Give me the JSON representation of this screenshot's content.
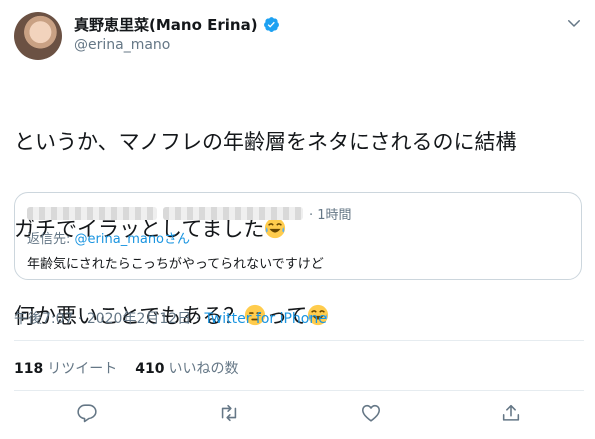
{
  "author": {
    "display_name": "真野恵里菜(Mano Erina)",
    "handle": "@erina_mano",
    "verified": true
  },
  "tweet": {
    "line1": "というか、マノフレの年齢層をネタにされるのに結構",
    "line2": "ガチでイラッとしてました",
    "line3_a": "何か悪いことでもある？",
    "line3_b": "って",
    "emoji": [
      "face-with-tears-of-joy",
      "expressionless-face",
      "face-with-tears-of-joy"
    ]
  },
  "quoted": {
    "time_suffix": "· 1時間",
    "reply_prefix": "返信先:",
    "reply_to": "@erina_manoさん",
    "text": "年齢気にされたらこっちがやってられないですけど"
  },
  "meta": {
    "time": "午後7:07",
    "date": "2020年2月12日",
    "sep": "·",
    "source": "Twitter for iPhone"
  },
  "stats": {
    "retweets_count": "118",
    "retweets_label": "リツイート",
    "likes_count": "410",
    "likes_label": "いいねの数"
  },
  "actions": [
    "reply-icon",
    "retweet-icon",
    "like-icon",
    "share-icon"
  ],
  "colors": {
    "link": "#1b95e0",
    "secondary": "#657786",
    "border": "#e6ecf0"
  }
}
